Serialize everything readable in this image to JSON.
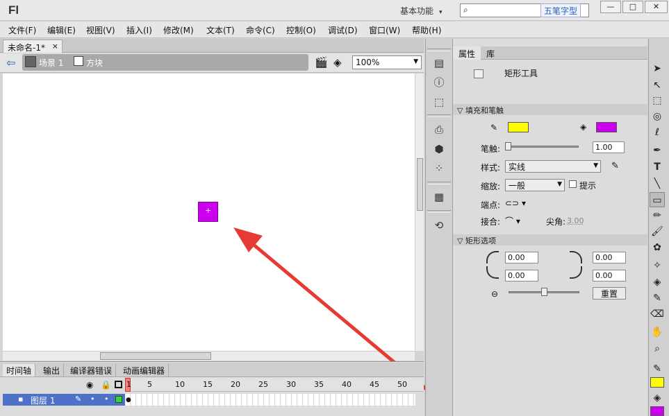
{
  "app": {
    "logo": "Fl",
    "workspace": "基本功能",
    "ime_label": "五笔字型"
  },
  "window": {
    "min": "—",
    "max": "□",
    "close": "✕"
  },
  "menu": [
    "文件(F)",
    "编辑(E)",
    "视图(V)",
    "插入(I)",
    "修改(M)",
    "文本(T)",
    "命令(C)",
    "控制(O)",
    "调试(D)",
    "窗口(W)",
    "帮助(H)"
  ],
  "document": {
    "tab_title": "未命名-1*",
    "close": "×"
  },
  "editbar": {
    "scene": "场景 1",
    "symbol": "方块",
    "zoom": "100%"
  },
  "stage": {
    "square_color": "#cc00ee",
    "arrow_color": "#e83a35"
  },
  "timeline": {
    "tabs": [
      "时间轴",
      "输出",
      "编译器错误",
      "动画编辑器"
    ],
    "frame_numbers": [
      "1",
      "5",
      "10",
      "15",
      "20",
      "25",
      "30",
      "35",
      "40",
      "45",
      "50"
    ],
    "layer_name": "图层 1"
  },
  "properties": {
    "tabs": [
      "属性",
      "库"
    ],
    "tool_name": "矩形工具",
    "fill_stroke_header": "填充和笔触",
    "stroke_color": "#ffff00",
    "fill_color": "#cc00ee",
    "stroke_label": "笔触:",
    "stroke_value": "1.00",
    "style_label": "样式:",
    "style_value": "实线",
    "scale_label": "缩放:",
    "scale_value": "一般",
    "hint_label": "提示",
    "cap_label": "端点:",
    "join_label": "接合:",
    "miter_label": "尖角:",
    "miter_value": "3.00",
    "rect_options_header": "矩形选项",
    "corner_tl": "0.00",
    "corner_tr": "0.00",
    "corner_bl": "0.00",
    "corner_br": "0.00",
    "reset_label": "重置"
  },
  "toolbox": {
    "stroke_color": "#ffff00",
    "fill_color": "#cc00ee"
  }
}
